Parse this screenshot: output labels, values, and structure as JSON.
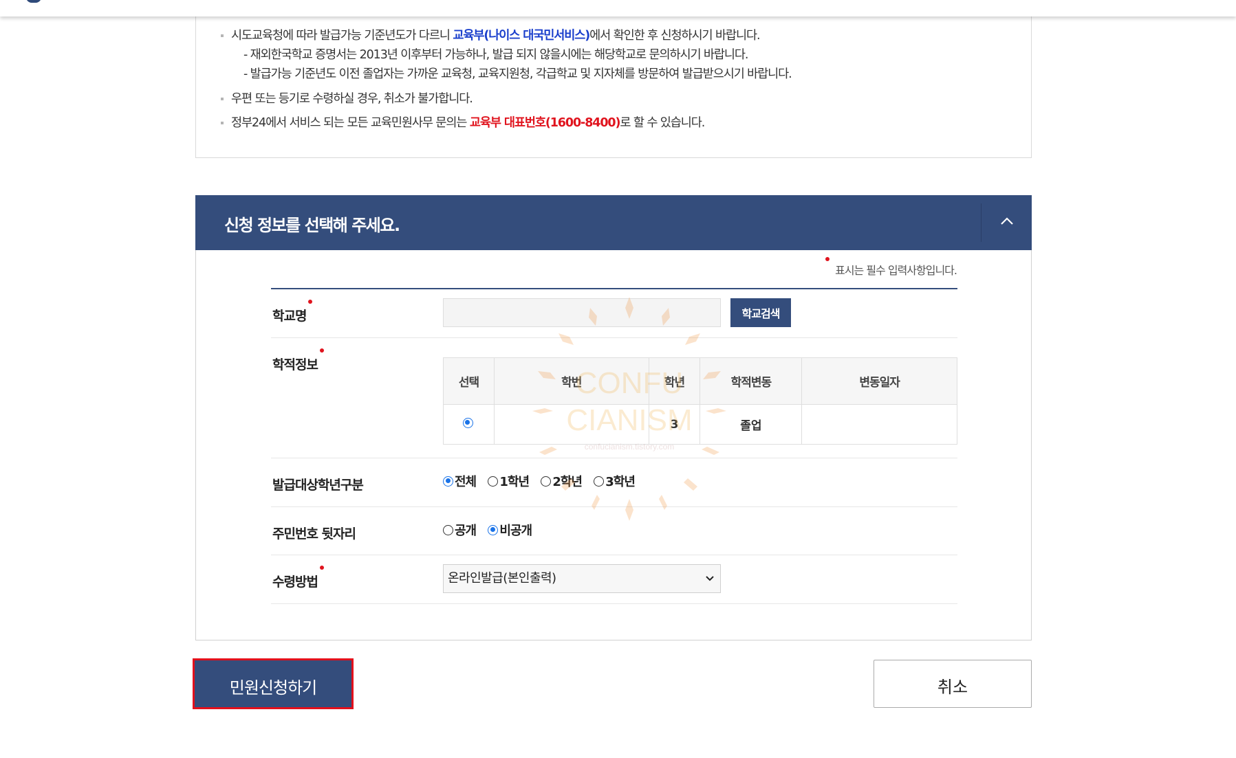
{
  "notice": {
    "line1_pre": "시도교육청에 따라 발급가능 기준년도가 다르니 ",
    "line1_link": "교육부(나이스 대국민서비스)",
    "line1_post": "에서 확인한 후 신청하시기 바랍니다.",
    "sub1": "- 재외한국학교 증명서는 2013년 이후부터 가능하나, 발급 되지 않을시에는 해당학교로 문의하시기 바랍니다.",
    "sub2": "- 발급가능 기준년도 이전 졸업자는 가까운 교육청, 교육지원청, 각급학교 및 지자체를 방문하여 발급받으시기 바랍니다.",
    "line2": "우편 또는 등기로 수령하실 경우, 취소가 불가합니다.",
    "line3_pre": "정부24에서 서비스 되는 모든 교육민원사무 문의는 ",
    "line3_hl": "교육부 대표번호(1600-8400)",
    "line3_post": "로 할 수 있습니다."
  },
  "panel": {
    "title": "신청 정보를 선택해 주세요.",
    "toggle_icon": "chevron-up-icon",
    "required_note": "표시는 필수 입력사항입니다."
  },
  "form": {
    "school": {
      "label": "학교명",
      "value": "",
      "button": "학교검색"
    },
    "record": {
      "label": "학적정보",
      "headers": [
        "선택",
        "학번",
        "학년",
        "학적변동",
        "변동일자"
      ],
      "rows": [
        {
          "selected": true,
          "student_no": "",
          "grade": "3",
          "status": "졸업",
          "date": ""
        }
      ]
    },
    "target_grade": {
      "label": "발급대상학년구분",
      "options": [
        "전체",
        "1학년",
        "2학년",
        "3학년"
      ],
      "selected": "전체"
    },
    "resident_no": {
      "label": "주민번호 뒷자리",
      "options": [
        "공개",
        "비공개"
      ],
      "selected": "비공개"
    },
    "receive": {
      "label": "수령방법",
      "selected": "온라인발급(본인출력)"
    }
  },
  "watermark": {
    "line1": "CONFU",
    "line2": "CIANISM",
    "site": "confucianism.tistory.com"
  },
  "buttons": {
    "apply": "민원신청하기",
    "cancel": "취소"
  },
  "colors": {
    "primary": "#344d7c",
    "required": "#e0141e",
    "link": "#1a3fcc",
    "highlight_border": "#e3101c"
  }
}
